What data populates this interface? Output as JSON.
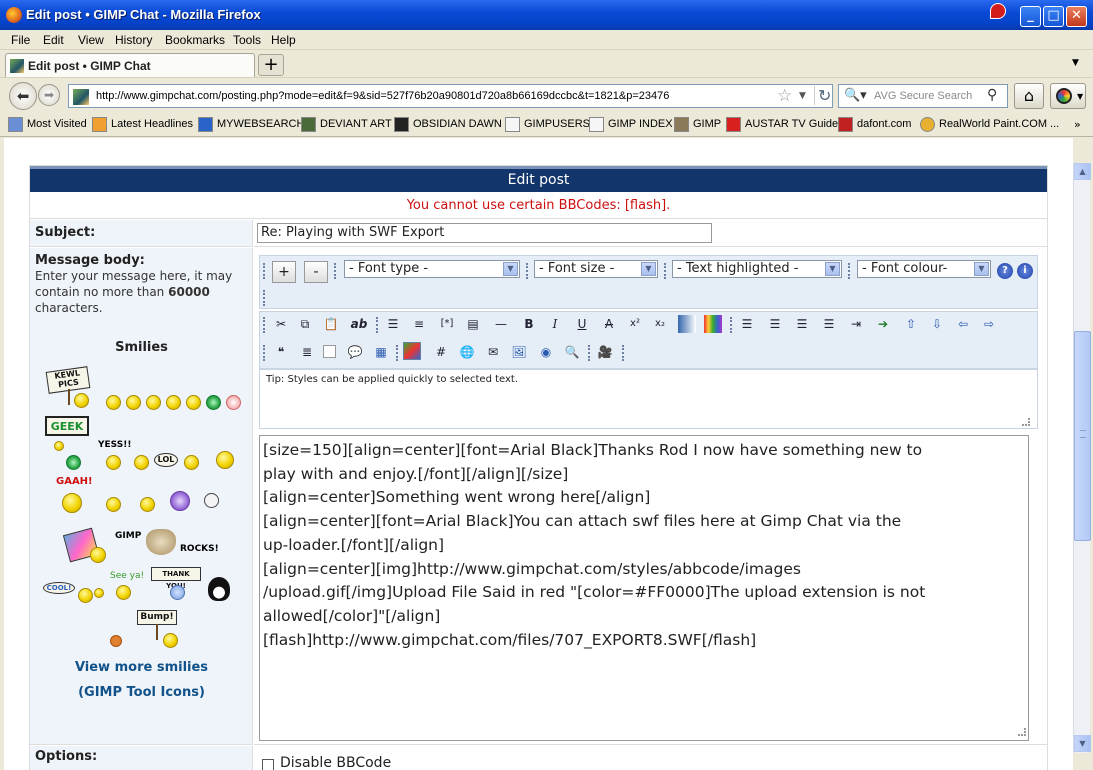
{
  "window": {
    "title": "Edit post • GIMP Chat - Mozilla Firefox",
    "min_label": "_",
    "max_label": "□",
    "close_label": "✕"
  },
  "menu": [
    "File",
    "Edit",
    "View",
    "History",
    "Bookmarks",
    "Tools",
    "Help"
  ],
  "tab": {
    "title": "Edit post • GIMP Chat",
    "new_tab_label": "+"
  },
  "nav": {
    "url": "http://www.gimpchat.com/posting.php?mode=edit&f=9&sid=527f76b20a90801d720a8b66169dccbc&t=1821&p=23476",
    "search_placeholder": "AVG Secure Search"
  },
  "bookmarks": [
    "Most Visited",
    "Latest Headlines",
    "MYWEBSEARCH",
    "DEVIANT ART",
    "OBSIDIAN DAWN",
    "GIMPUSERS",
    "GIMP INDEX",
    "GIMP",
    "AUSTAR TV Guide",
    "dafont.com",
    "RealWorld Paint.COM ..."
  ],
  "page": {
    "header": "Edit post",
    "error": "You cannot use certain BBCodes: [flash].",
    "subject_label": "Subject:",
    "subject_value": "Re: Playing with SWF Export",
    "body_label": "Message body:",
    "body_help_1": "Enter your message here, it may contain no more than",
    "body_help_limit": "60000",
    "body_help_2": "characters.",
    "smilies_title": "Smilies",
    "smilie_texts": {
      "kewl": "KEWL PICS",
      "geek": "GEEK",
      "yess": "YESS!!",
      "lol": "LOL",
      "gaah": "GAAH!",
      "gimp": "GIMP",
      "rocks": "ROCKS!",
      "cool": "COOL!",
      "seeya": "See ya!",
      "thanks": "THANK YOU!",
      "bump": "Bump!"
    },
    "more_smilies": "View more smilies",
    "gimp_icons": "(GIMP Tool Icons)",
    "options_label": "Options:",
    "disable_bbcode": "Disable BBCode"
  },
  "editor": {
    "plus": "+",
    "minus": "-",
    "font_type": "- Font type -",
    "font_size": "- Font size -",
    "text_highlighted": "- Text highlighted -",
    "font_colour": "- Font colour-",
    "tip": "Tip: Styles can be applied quickly to selected text.",
    "message_lines": [
      "[size=150][align=center][font=Arial Black]Thanks Rod I now have something new to",
      "play with and enjoy.[/font][/align][/size]",
      "[align=center]Something went wrong here[/align]",
      "[align=center][font=Arial Black]You can attach swf files here at Gimp Chat via the",
      "up-loader.[/font][/align]",
      "[align=center][img]http://www.gimpchat.com/styles/abbcode/images",
      "/upload.gif[/img]Upload File Said in red  \"[color=#FF0000]The upload extension is not",
      "allowed[/color]\"[/align]",
      "[flash]http://www.gimpchat.com/files/707_EXPORT8.SWF[/flash]"
    ]
  },
  "colors": {
    "titlebar": "#0a4ad6",
    "header": "#12366c",
    "error": "#cc1010",
    "link": "#105289",
    "label_bg": "#eff4fa"
  }
}
